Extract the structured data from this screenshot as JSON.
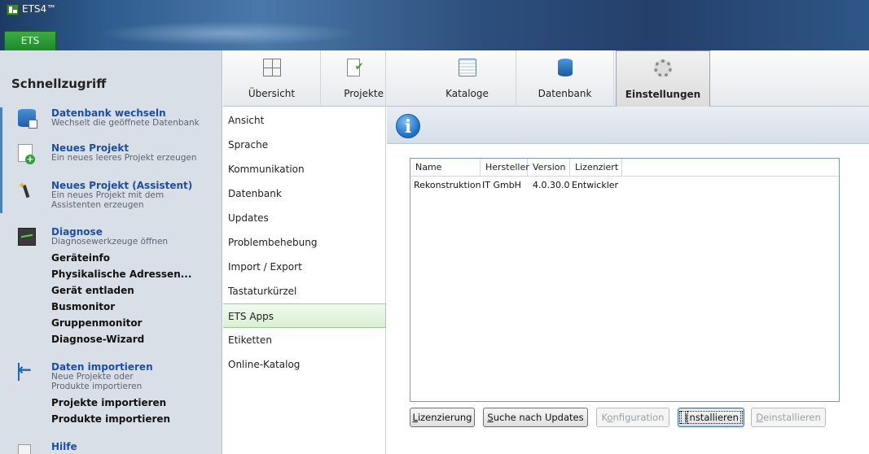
{
  "window": {
    "title": "ETS4™",
    "app_tab": "ETS"
  },
  "quick_access": {
    "title": "Schnellzugriff",
    "items": [
      {
        "head": "Datenbank wechseln",
        "desc": "Wechselt die geöffnete Datenbank",
        "icon": "database-switch-icon"
      },
      {
        "head": "Neues Projekt",
        "desc": "Ein neues leeres Projekt erzeugen",
        "icon": "new-project-icon"
      },
      {
        "head": "Neues Projekt (Assistent)",
        "desc": "Ein neues Projekt mit dem Assistenten erzeugen",
        "icon": "wizard-icon"
      },
      {
        "head": "Diagnose",
        "desc": "Diagnosewerkzeuge öffnen",
        "icon": "diagnostics-icon"
      },
      {
        "head": "Daten importieren",
        "desc": "Neue Projekte oder Produkte importieren",
        "icon": "import-icon"
      },
      {
        "head": "Hilfe",
        "desc": "",
        "icon": "help-icon"
      }
    ],
    "diagnose_sub": [
      "Geräteinfo",
      "Physikalische Adressen...",
      "Gerät entladen",
      "Busmonitor",
      "Gruppenmonitor",
      "Diagnose-Wizard"
    ],
    "import_sub": [
      "Projekte importieren",
      "Produkte importieren"
    ]
  },
  "ribbon": {
    "tabs": [
      {
        "label": "Übersicht",
        "icon": "overview-icon"
      },
      {
        "label": "Projekte",
        "icon": "projects-icon"
      },
      {
        "label": "Kataloge",
        "icon": "catalogs-icon"
      },
      {
        "label": "Datenbank",
        "icon": "database-icon"
      },
      {
        "label": "Einstellungen",
        "icon": "settings-gear-icon"
      }
    ],
    "active": "Einstellungen"
  },
  "settings_nav": {
    "items": [
      "Ansicht",
      "Sprache",
      "Kommunikation",
      "Datenbank",
      "Updates",
      "Problembehebung",
      "Import / Export",
      "Tastaturkürzel",
      "ETS Apps",
      "Etiketten",
      "Online-Katalog"
    ],
    "selected": "ETS Apps"
  },
  "apps_table": {
    "columns": [
      "Name",
      "Hersteller",
      "Version",
      "Lizenziert"
    ],
    "rows": [
      [
        "Rekonstruktion",
        "IT GmbH",
        "4.0.30.0",
        "Entwickler"
      ]
    ]
  },
  "buttons": {
    "license": {
      "pre": "",
      "key": "L",
      "post": "izenzierung"
    },
    "updates": {
      "pre": "",
      "key": "S",
      "post": "uche nach Updates"
    },
    "config": {
      "pre": "K",
      "key": "o",
      "post": "nfiguration"
    },
    "install": {
      "pre": "",
      "key": "I",
      "post": "nstallieren"
    },
    "uninstall": {
      "pre": "",
      "key": "D",
      "post": "einstallieren"
    }
  },
  "colors": {
    "accent_green": "#2f9e36",
    "link_blue": "#1d4ea3",
    "title_blue": "#2d4f7d"
  }
}
